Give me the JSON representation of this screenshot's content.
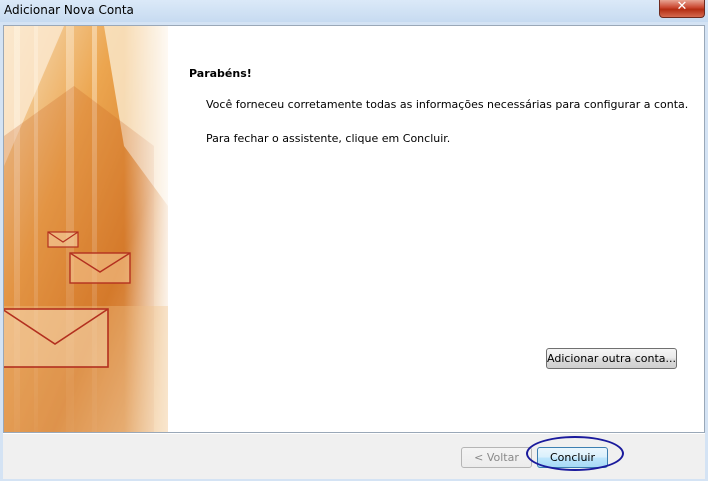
{
  "window": {
    "title": "Adicionar Nova Conta",
    "close_label": "✕"
  },
  "content": {
    "heading": "Parabéns!",
    "message1": "Você forneceu corretamente todas as informações necessárias para configurar a conta.",
    "message2": "Para fechar o assistente, clique em Concluir."
  },
  "buttons": {
    "add_another_account": "Adicionar outra conta...",
    "back": "< Voltar",
    "finish": "Concluir"
  },
  "colors": {
    "accent_ring": "#1a1a9c",
    "art_orange": "#e38a2c"
  },
  "icons": [
    "envelope-icon",
    "close-icon"
  ]
}
